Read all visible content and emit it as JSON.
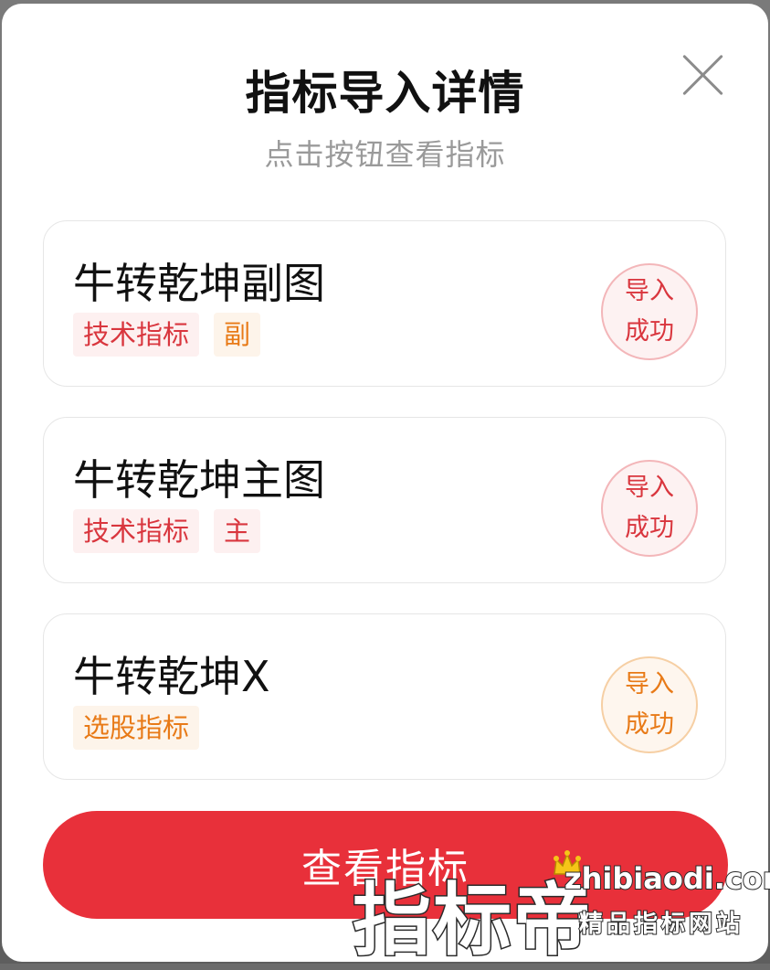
{
  "modal": {
    "title": "指标导入详情",
    "subtitle": "点击按钮查看指标",
    "close_icon": "close-icon"
  },
  "indicators": [
    {
      "name": "牛转乾坤副图",
      "tags": [
        {
          "label": "技术指标",
          "color": "red"
        },
        {
          "label": "副",
          "color": "orange"
        }
      ],
      "status_line1": "导入",
      "status_line2": "成功",
      "status_color": "red"
    },
    {
      "name": "牛转乾坤主图",
      "tags": [
        {
          "label": "技术指标",
          "color": "red"
        },
        {
          "label": "主",
          "color": "red"
        }
      ],
      "status_line1": "导入",
      "status_line2": "成功",
      "status_color": "red"
    },
    {
      "name": "牛转乾坤X",
      "tags": [
        {
          "label": "选股指标",
          "color": "orange"
        }
      ],
      "status_line1": "导入",
      "status_line2": "成功",
      "status_color": "orange"
    }
  ],
  "view_button": {
    "label": "查看指标"
  },
  "watermark": {
    "brand": "指标帝",
    "domain": "zhibiaodi.com",
    "slogan": "精品指标网站"
  },
  "colors": {
    "accent_red": "#e8303a",
    "tag_red": "#d9363e",
    "tag_orange": "#e87a17"
  }
}
